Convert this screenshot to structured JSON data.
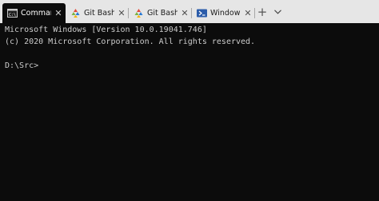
{
  "tabs": [
    {
      "title": "Command Prompt",
      "icon": "command-prompt-icon",
      "close": "✕",
      "active": true
    },
    {
      "title": "Git Bash /",
      "icon": "git-bash-icon",
      "close": "✕",
      "active": false
    },
    {
      "title": "Git Bash /",
      "icon": "git-bash-icon",
      "close": "✕",
      "active": false
    },
    {
      "title": "Windows",
      "icon": "powershell-icon",
      "close": "✕",
      "active": false
    }
  ],
  "new_tab_label": "+",
  "terminal": {
    "lines": [
      "Microsoft Windows [Version 10.0.19041.746]",
      "(c) 2020 Microsoft Corporation. All rights reserved.",
      "",
      "D:\\Src>"
    ]
  },
  "colors": {
    "tabbar_bg": "#e6e6e6",
    "terminal_bg": "#0c0c0c",
    "terminal_text": "#cccccc",
    "powershell_blue": "#2b5caa"
  }
}
